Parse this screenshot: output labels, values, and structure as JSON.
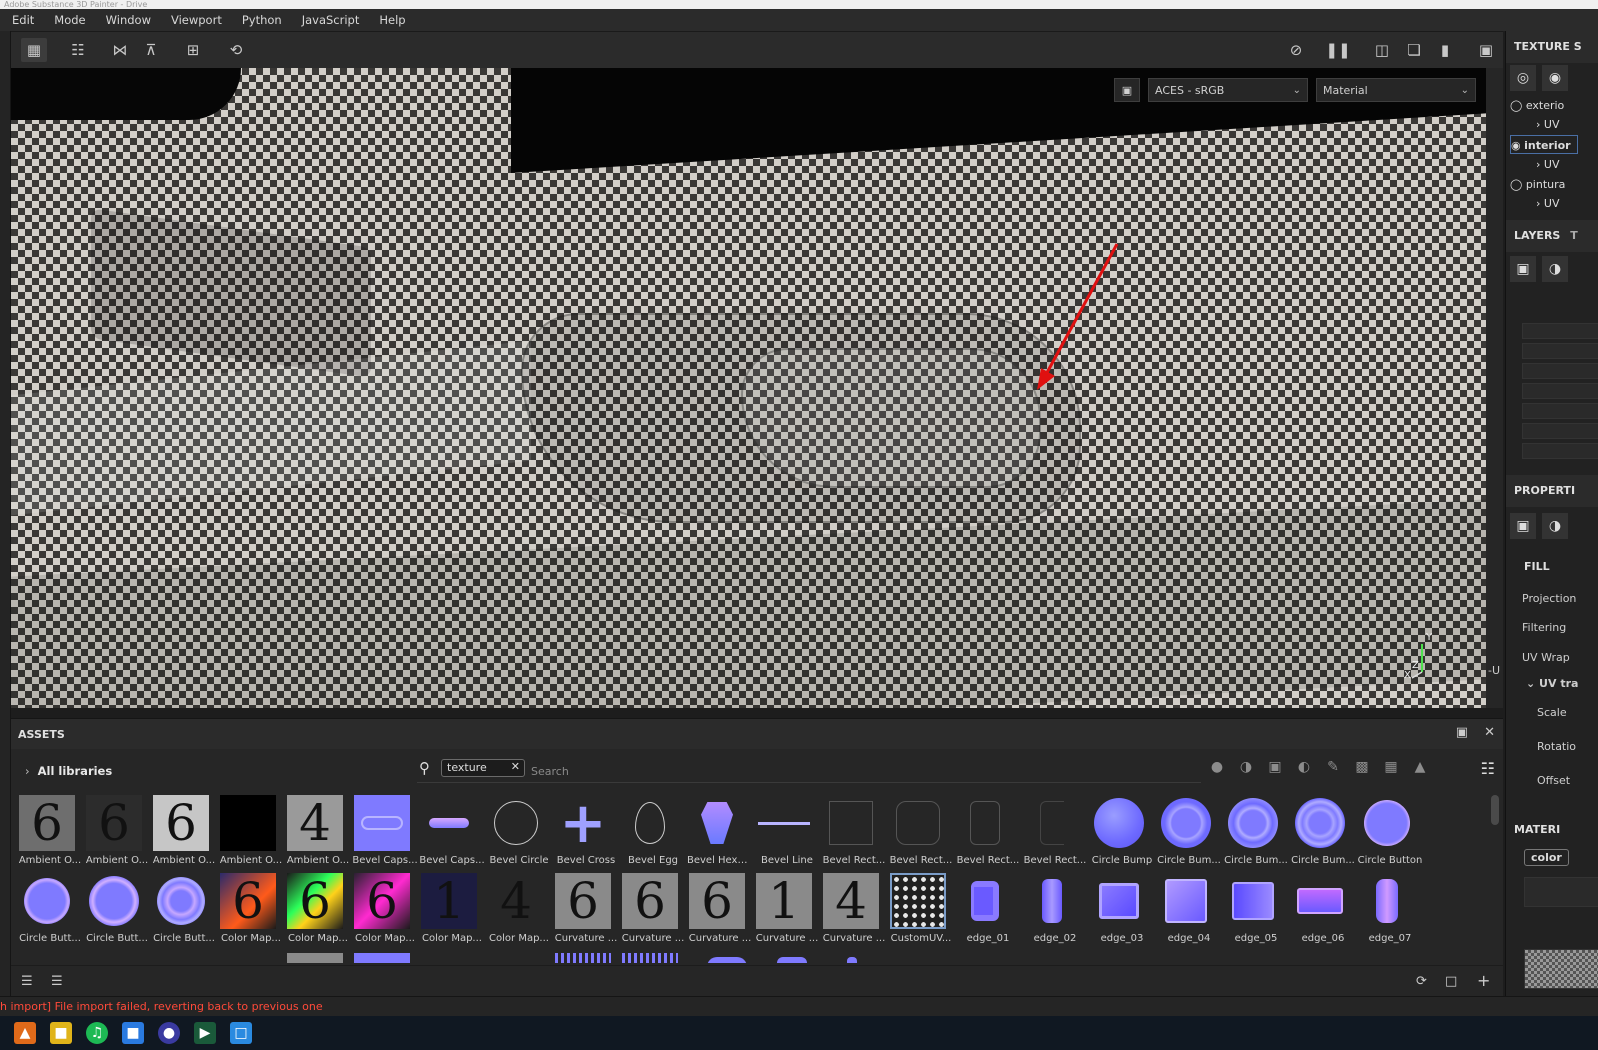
{
  "window": {
    "title": "Adobe Substance 3D Painter - Drive"
  },
  "menu": [
    "Edit",
    "Mode",
    "Window",
    "Viewport",
    "Python",
    "JavaScript",
    "Help"
  ],
  "viewport": {
    "colorspace": "ACES - sRGB",
    "channel": "Material",
    "axis_y": "Y",
    "axis_z": "Z",
    "axis_x": "X",
    "u_label": "-U"
  },
  "right_panel": {
    "texture_set_title": "TEXTURE S",
    "texture_sets": [
      {
        "name": "exterio",
        "uv": "UV"
      },
      {
        "name": "interior",
        "uv": "UV"
      },
      {
        "name": "pintura",
        "uv": "UV"
      }
    ],
    "layers_tab": "LAYERS",
    "layers_tab2": "T",
    "properties_title": "PROPERTI",
    "fill_title": "FILL",
    "projection_label": "Projection",
    "filtering_label": "Filtering",
    "uvwrap_label": "UV Wrap",
    "uvtrans_label": "UV tra",
    "scale_label": "Scale",
    "rotation_label": "Rotatio",
    "offset_label": "Offset",
    "material_title": "MATERI",
    "color_chip": "color"
  },
  "assets": {
    "title": "ASSETS",
    "library": "All libraries",
    "search_tag": "texture",
    "search_placeholder": "Search",
    "row1": [
      {
        "name": "Ambient O...",
        "glyph": "6",
        "bg": "#6e6e6e"
      },
      {
        "name": "Ambient O...",
        "glyph": "6",
        "bg": "#2c2c2c"
      },
      {
        "name": "Ambient O...",
        "glyph": "6",
        "bg": "#c6c6c6"
      },
      {
        "name": "Ambient O...",
        "glyph": "",
        "bg": "#000000"
      },
      {
        "name": "Ambient O...",
        "glyph": "4",
        "bg": "#9a9a9a"
      },
      {
        "name": "Bevel Caps...",
        "glyph": "",
        "bg": "#7f7aff"
      },
      {
        "name": "Bevel Caps...",
        "glyph": "",
        "bg": "#262626"
      },
      {
        "name": "Bevel Circle",
        "glyph": "",
        "bg": "#262626"
      },
      {
        "name": "Bevel Cross",
        "glyph": "",
        "bg": "#262626"
      },
      {
        "name": "Bevel Egg",
        "glyph": "",
        "bg": "#262626"
      },
      {
        "name": "Bevel Hexa...",
        "glyph": "",
        "bg": "#262626"
      },
      {
        "name": "Bevel Line",
        "glyph": "",
        "bg": "#262626"
      },
      {
        "name": "Bevel Rect...",
        "glyph": "",
        "bg": "#262626"
      },
      {
        "name": "Bevel Rect...",
        "glyph": "",
        "bg": "#262626"
      },
      {
        "name": "Bevel Rect...",
        "glyph": "",
        "bg": "#262626"
      },
      {
        "name": "Bevel Rect...",
        "glyph": "",
        "bg": "#262626"
      },
      {
        "name": "Circle Bump",
        "glyph": "",
        "bg": "#262626"
      },
      {
        "name": "Circle Bum...",
        "glyph": "",
        "bg": "#262626"
      },
      {
        "name": "Circle Bum...",
        "glyph": "",
        "bg": "#262626"
      },
      {
        "name": "Circle Bum...",
        "glyph": "",
        "bg": "#262626"
      },
      {
        "name": "Circle Button",
        "glyph": "",
        "bg": "#262626"
      }
    ],
    "row2": [
      {
        "name": "Circle Butt...",
        "glyph": "",
        "bg": "#262626"
      },
      {
        "name": "Circle Butt...",
        "glyph": "",
        "bg": "#262626"
      },
      {
        "name": "Circle Butt...",
        "glyph": "",
        "bg": "#262626"
      },
      {
        "name": "Color Map...",
        "glyph": "6",
        "bg": "#2a2a6a"
      },
      {
        "name": "Color Map...",
        "glyph": "6",
        "bg": "#1a1a1a"
      },
      {
        "name": "Color Map...",
        "glyph": "6",
        "bg": "#2a2030"
      },
      {
        "name": "Color Map...",
        "glyph": "1",
        "bg": "#1c1c40"
      },
      {
        "name": "Color Map...",
        "glyph": "4",
        "bg": "#262626"
      },
      {
        "name": "Curvature ...",
        "glyph": "6",
        "bg": "#8a8a8a"
      },
      {
        "name": "Curvature ...",
        "glyph": "6",
        "bg": "#8a8a8a"
      },
      {
        "name": "Curvature ...",
        "glyph": "6",
        "bg": "#8a8a8a"
      },
      {
        "name": "Curvature ...",
        "glyph": "1",
        "bg": "#8a8a8a"
      },
      {
        "name": "Curvature ...",
        "glyph": "4",
        "bg": "#8a8a8a"
      },
      {
        "name": "CustomUV...",
        "glyph": "",
        "bg": "#202020"
      },
      {
        "name": "edge_01",
        "glyph": "",
        "bg": "#262626"
      },
      {
        "name": "edge_02",
        "glyph": "",
        "bg": "#262626"
      },
      {
        "name": "edge_03",
        "glyph": "",
        "bg": "#262626"
      },
      {
        "name": "edge_04",
        "glyph": "",
        "bg": "#262626"
      },
      {
        "name": "edge_05",
        "glyph": "",
        "bg": "#262626"
      },
      {
        "name": "edge_06",
        "glyph": "",
        "bg": "#262626"
      },
      {
        "name": "edge_07",
        "glyph": "",
        "bg": "#262626"
      }
    ]
  },
  "status": {
    "message": "h import] File import failed, reverting back to previous one"
  },
  "colors": {
    "accent": "#7f7aff",
    "error": "#ff4a3a",
    "arrow": "#e01010"
  }
}
